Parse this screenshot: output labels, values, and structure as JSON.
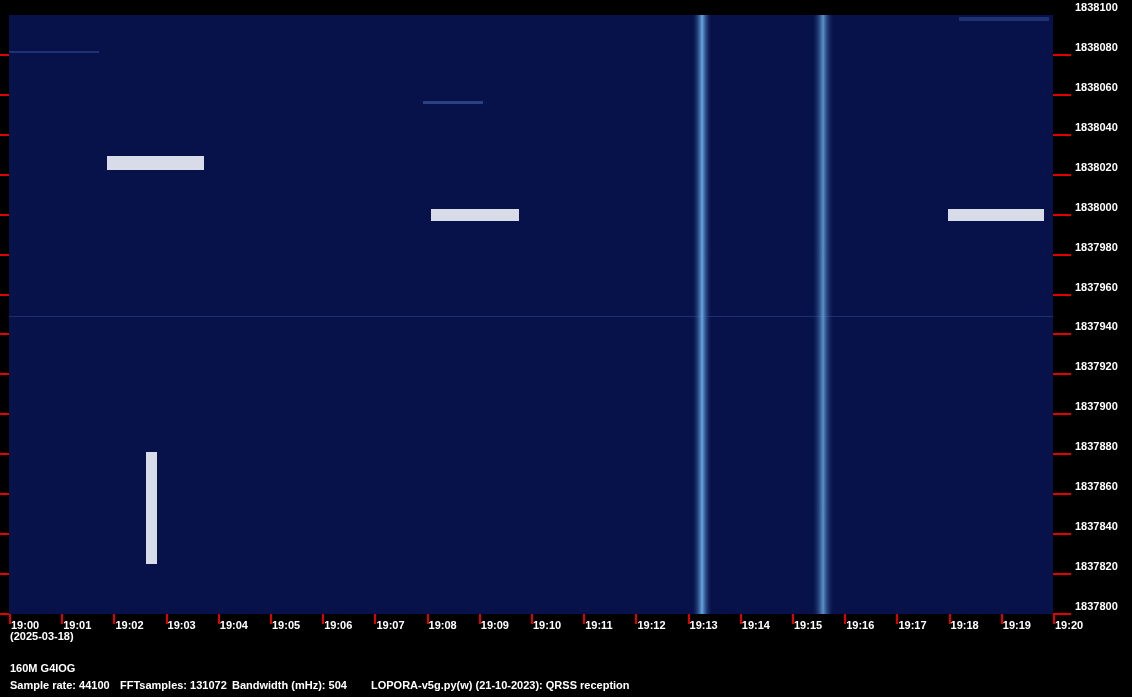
{
  "y_axis": {
    "labels": [
      "1838100",
      "1838080",
      "1838060",
      "1838040",
      "1838020",
      "1838000",
      "1837980",
      "1837960",
      "1837940",
      "1837920",
      "1837900",
      "1837880",
      "1837860",
      "1837840",
      "1837820",
      "1837800"
    ]
  },
  "x_axis": {
    "labels": [
      "19:00",
      "19:01",
      "19:02",
      "19:03",
      "19:04",
      "19:05",
      "19:06",
      "19:07",
      "19:08",
      "19:09",
      "19:10",
      "19:11",
      "19:12",
      "19:13",
      "19:14",
      "19:15",
      "19:16",
      "19:17",
      "19:18",
      "19:19",
      "19:20"
    ],
    "date": "(2025-03-18)"
  },
  "station": "160M G4IOG",
  "info": [
    "Sample rate: 44100",
    "FFTsamples: 131072",
    "Bandwidth (mHz): 504",
    "LOPORA-v5g.py(w) (21-10-2023): QRSS reception"
  ]
}
